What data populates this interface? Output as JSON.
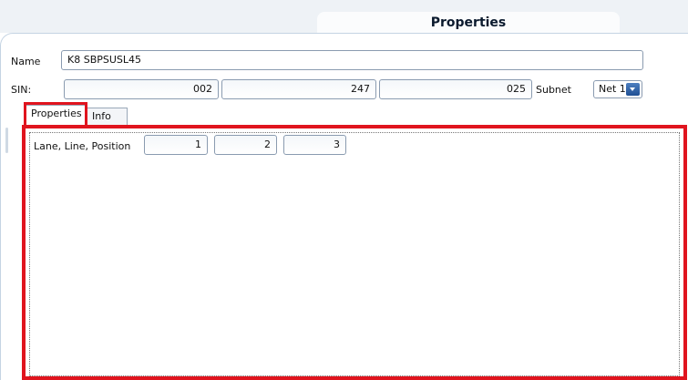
{
  "header": {
    "title": "Properties"
  },
  "form": {
    "name_label": "Name",
    "name_value": "K8 SBPSUSL45",
    "sin_label": "SIN:",
    "sin_values": [
      "002",
      "247",
      "025"
    ],
    "subnet_label": "Subnet",
    "subnet_value": "Net 1"
  },
  "tabs": [
    {
      "label": "Properties",
      "active": true
    },
    {
      "label": "Info",
      "active": false
    }
  ],
  "properties": {
    "position_label": "Lane, Line, Position",
    "position_values": [
      "1",
      "2",
      "3"
    ]
  },
  "colors": {
    "highlight": "#e0141e",
    "dropdown_accent": "#1f4f94"
  }
}
